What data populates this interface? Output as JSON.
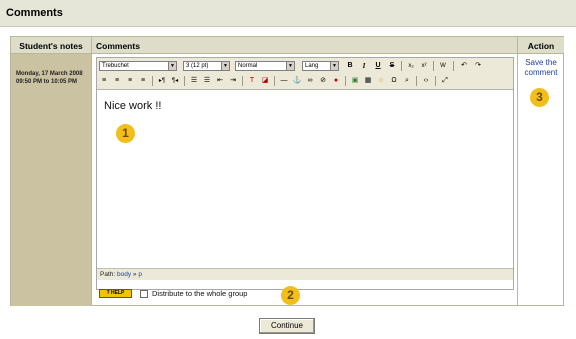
{
  "header": {
    "title": "Comments"
  },
  "table": {
    "col_notes": "Student's notes",
    "col_comments": "Comments",
    "col_action": "Action"
  },
  "notes": {
    "date": "Monday, 17 March 2008 09:50 PM to 10:05 PM"
  },
  "editor": {
    "font_select": "Trebuchet",
    "size_select": "3 (12 pt)",
    "format_select": "Normal",
    "lang_select": "Lang",
    "content_text": "Nice work !!",
    "path_label": "Path:",
    "path_body": "body",
    "path_sep": "»",
    "path_p": "p",
    "help_label": "? HELP"
  },
  "action": {
    "save_label": "Save the comment"
  },
  "distribute": {
    "label": "Distribute to the whole group",
    "checked": false
  },
  "badges": {
    "b1": "1",
    "b2": "2",
    "b3": "3"
  },
  "footer": {
    "continue_label": "Continue"
  },
  "colors": {
    "header_bg": "#e6e6d8",
    "notes_bg": "#cbc2a2",
    "badge": "#f2be1a",
    "link": "#1b3fa8"
  }
}
